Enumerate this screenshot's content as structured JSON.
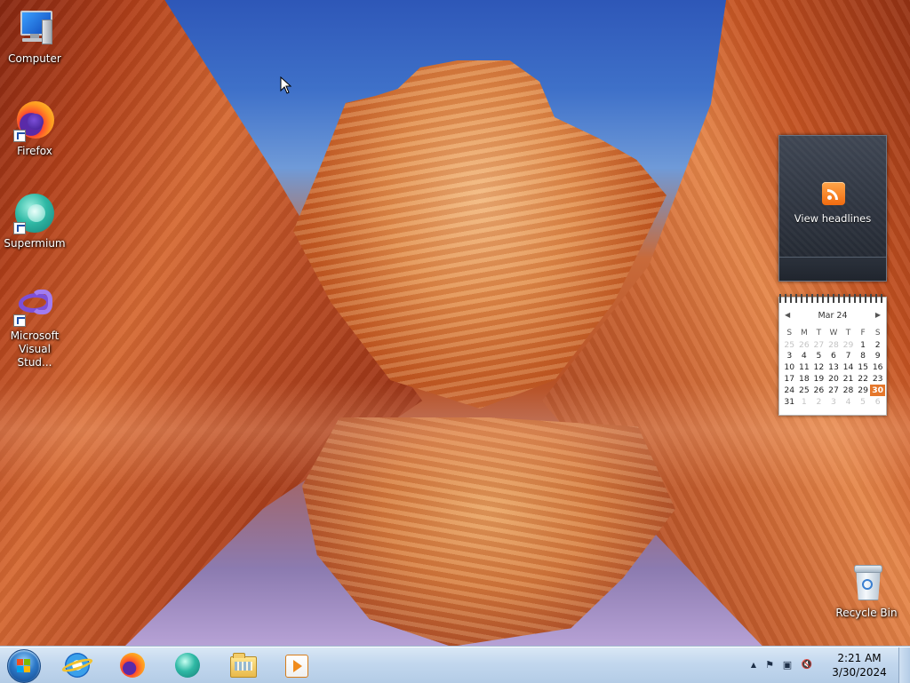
{
  "desktop": {
    "icons": [
      {
        "label": "Computer",
        "icon": "computer-icon"
      },
      {
        "label": "Firefox",
        "icon": "firefox-icon"
      },
      {
        "label": "Supermium",
        "icon": "supermium-icon"
      },
      {
        "label": "Microsoft Visual Stud...",
        "icon": "visual-studio-icon"
      },
      {
        "label": "Recycle Bin",
        "icon": "recycle-bin-icon"
      }
    ]
  },
  "gadgets": {
    "feed_headlines": {
      "label": "View headlines",
      "icon": "rss-icon"
    },
    "calendar": {
      "month_label": "Mar 24",
      "prev_icon": "◀",
      "next_icon": "▶",
      "weekdays": [
        "S",
        "M",
        "T",
        "W",
        "T",
        "F",
        "S"
      ],
      "weeks": [
        [
          "25",
          "26",
          "27",
          "28",
          "29",
          "1",
          "2"
        ],
        [
          "3",
          "4",
          "5",
          "6",
          "7",
          "8",
          "9"
        ],
        [
          "10",
          "11",
          "12",
          "13",
          "14",
          "15",
          "16"
        ],
        [
          "17",
          "18",
          "19",
          "20",
          "21",
          "22",
          "23"
        ],
        [
          "24",
          "25",
          "26",
          "27",
          "28",
          "29",
          "30"
        ],
        [
          "31",
          "1",
          "2",
          "3",
          "4",
          "5",
          "6"
        ]
      ],
      "today": "30",
      "accent": "#e5772b"
    }
  },
  "taskbar": {
    "start_icon": "windows-logo-icon",
    "pinned": [
      {
        "name": "Internet Explorer",
        "icon": "internet-explorer-icon"
      },
      {
        "name": "Firefox",
        "icon": "firefox-icon"
      },
      {
        "name": "Supermium",
        "icon": "supermium-icon"
      },
      {
        "name": "Windows Explorer",
        "icon": "folder-icon"
      },
      {
        "name": "Windows Media Player",
        "icon": "media-player-icon"
      }
    ],
    "tray": {
      "overflow_glyph": "▲",
      "flag_glyph": "⚑",
      "network_glyph": "▣",
      "volume_glyph": "🔇",
      "time": "2:21 AM",
      "date": "3/30/2024"
    }
  }
}
